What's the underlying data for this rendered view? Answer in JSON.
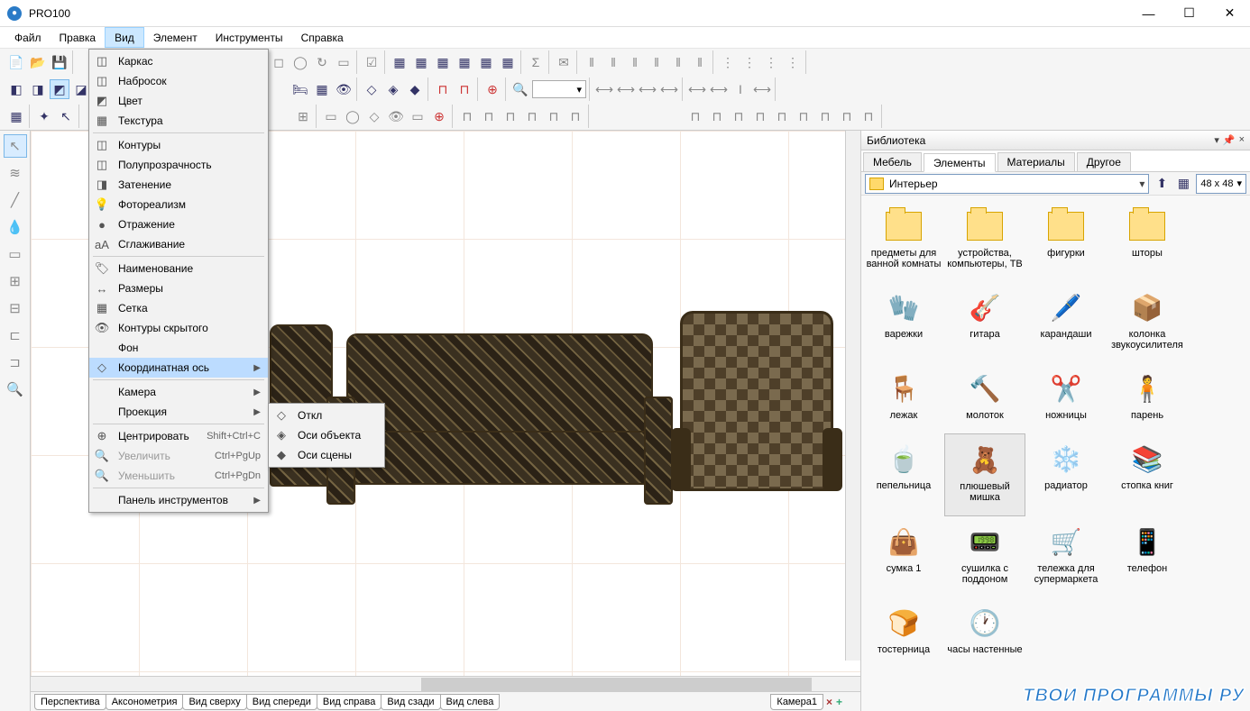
{
  "app": {
    "title": "PRO100"
  },
  "menu": {
    "items": [
      "Файл",
      "Правка",
      "Вид",
      "Элемент",
      "Инструменты",
      "Справка"
    ],
    "active": 2
  },
  "dropdown_view": {
    "items": [
      {
        "label": "Каркас",
        "icon": "cube"
      },
      {
        "label": "Набросок",
        "icon": "cube"
      },
      {
        "label": "Цвет",
        "icon": "cube-fill"
      },
      {
        "label": "Текстура",
        "icon": "cube-tex"
      },
      {
        "sep": true
      },
      {
        "label": "Контуры",
        "icon": "cube"
      },
      {
        "label": "Полупрозрачность",
        "icon": "cube"
      },
      {
        "label": "Затенение",
        "icon": "cube-shade"
      },
      {
        "label": "Фотореализм",
        "icon": "bulb"
      },
      {
        "label": "Отражение",
        "icon": "sphere"
      },
      {
        "label": "Сглаживание",
        "icon": "aa"
      },
      {
        "sep": true
      },
      {
        "label": "Наименование",
        "icon": "tag"
      },
      {
        "label": "Размеры",
        "icon": "dim"
      },
      {
        "label": "Сетка",
        "icon": "grid"
      },
      {
        "label": "Контуры скрытого",
        "icon": "eye"
      },
      {
        "label": "Фон",
        "icon": ""
      },
      {
        "label": "Координатная ось",
        "icon": "axis",
        "submenu": true,
        "highlight": true
      },
      {
        "sep": true
      },
      {
        "label": "Камера",
        "icon": "",
        "submenu": true
      },
      {
        "label": "Проекция",
        "icon": "",
        "submenu": true
      },
      {
        "sep": true
      },
      {
        "label": "Центрировать",
        "shortcut": "Shift+Ctrl+C",
        "icon": "target"
      },
      {
        "label": "Увеличить",
        "shortcut": "Ctrl+PgUp",
        "icon": "zoom-in",
        "disabled": true
      },
      {
        "label": "Уменьшить",
        "shortcut": "Ctrl+PgDn",
        "icon": "zoom-out",
        "disabled": true
      },
      {
        "sep": true
      },
      {
        "label": "Панель инструментов",
        "icon": "",
        "submenu": true
      }
    ]
  },
  "submenu_axis": {
    "items": [
      {
        "label": "Откл",
        "icon": "diamond"
      },
      {
        "label": "Оси объекта",
        "icon": "diamond2"
      },
      {
        "label": "Оси сцены",
        "icon": "diamond3"
      }
    ]
  },
  "view_tabs": [
    "Перспектива",
    "Аксонометрия",
    "Вид сверху",
    "Вид спереди",
    "Вид справа",
    "Вид сзади",
    "Вид слева"
  ],
  "camera_tab": "Камера1",
  "library": {
    "title": "Библиотека",
    "tabs": [
      "Мебель",
      "Элементы",
      "Материалы",
      "Другое"
    ],
    "active_tab": 1,
    "path": "Интерьер",
    "thumb_size": "48 x  48",
    "items": [
      {
        "name": "предметы для ванной комнаты",
        "type": "folder"
      },
      {
        "name": "устройства, компьютеры, ТВ",
        "type": "folder"
      },
      {
        "name": "фигурки",
        "type": "folder"
      },
      {
        "name": "шторы",
        "type": "folder"
      },
      {
        "name": "варежки",
        "emoji": "🧤"
      },
      {
        "name": "гитара",
        "emoji": "🎸"
      },
      {
        "name": "карандаши",
        "emoji": "🖊️"
      },
      {
        "name": "колонка звукоусилителя",
        "emoji": "📦"
      },
      {
        "name": "лежак",
        "emoji": "🪑"
      },
      {
        "name": "молоток",
        "emoji": "🔨"
      },
      {
        "name": "ножницы",
        "emoji": "✂️"
      },
      {
        "name": "парень",
        "emoji": "🧍"
      },
      {
        "name": "пепельница",
        "emoji": "🍵"
      },
      {
        "name": "плюшевый мишка",
        "emoji": "🧸",
        "selected": true
      },
      {
        "name": "радиатор",
        "emoji": "❄️"
      },
      {
        "name": "стопка книг",
        "emoji": "📚"
      },
      {
        "name": "сумка 1",
        "emoji": "👜"
      },
      {
        "name": "сушилка с поддоном",
        "emoji": "📟"
      },
      {
        "name": "тележка для супермаркета",
        "emoji": "🛒"
      },
      {
        "name": "телефон",
        "emoji": "📱"
      },
      {
        "name": "тостерница",
        "emoji": "🍞"
      },
      {
        "name": "часы настенные",
        "emoji": "🕐"
      }
    ]
  },
  "watermark": "ТВОИ ПРОГРАММЫ РУ"
}
